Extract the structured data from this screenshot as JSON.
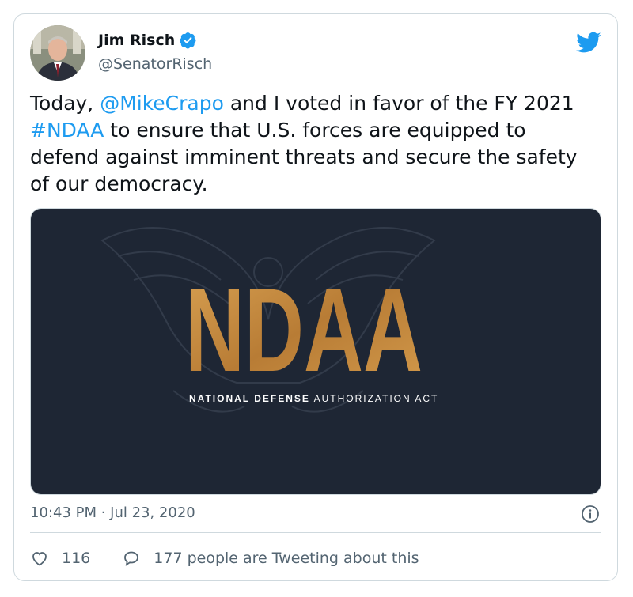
{
  "author": {
    "name": "Jim Risch",
    "handle": "@SenatorRisch"
  },
  "tweet": {
    "text_part1": "Today, ",
    "mention": "@MikeCrapo",
    "text_part2": " and I voted in favor of the FY 2021 ",
    "hashtag": "#NDAA",
    "text_part3": " to ensure that U.S. forces are equipped to defend against imminent threats and secure the safety of our democracy."
  },
  "media": {
    "logo_text": "NDAA",
    "subtitle_bold": "NATIONAL DEFENSE",
    "subtitle_light": " AUTHORIZATION ACT"
  },
  "meta": {
    "timestamp": "10:43 PM · Jul 23, 2020"
  },
  "actions": {
    "likes": "116",
    "tweeting": "177 people are Tweeting about this"
  },
  "colors": {
    "accent": "#1d9bf0",
    "text": "#0f1419",
    "secondary": "#536471",
    "media_bg": "#1e2634",
    "logo_gold": "#c38a3d"
  }
}
